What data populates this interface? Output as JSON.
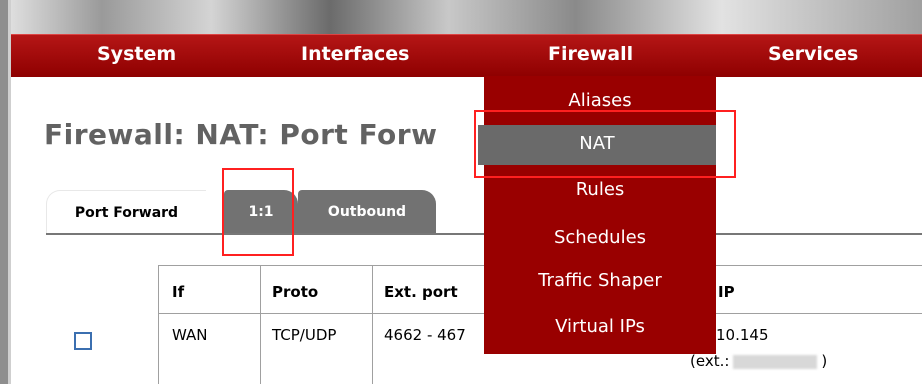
{
  "menubar": {
    "items": [
      "System",
      "Interfaces",
      "Firewall",
      "Services"
    ]
  },
  "page_title": "Firewall: NAT: Port Forw",
  "tabs": [
    "Port Forward",
    "1:1",
    "Outbound"
  ],
  "table": {
    "headers": [
      "If",
      "Proto",
      "Ext. port",
      "IP"
    ],
    "row": {
      "interface": "WAN",
      "proto": "TCP/UDP",
      "ext_port": "4662 - 467",
      "ip": "10.145",
      "ext_prefix": "(ext.:",
      "ext_suffix": ")"
    }
  },
  "firewall_menu": {
    "items": [
      "Aliases",
      "NAT",
      "Rules",
      "Schedules",
      "Traffic Shaper",
      "Virtual IPs"
    ],
    "highlighted": "NAT"
  },
  "colors": {
    "menubar": "#a00000",
    "dropdown": "#990000",
    "highlight": "#6a6a6a",
    "annotation": "#ff2020"
  }
}
